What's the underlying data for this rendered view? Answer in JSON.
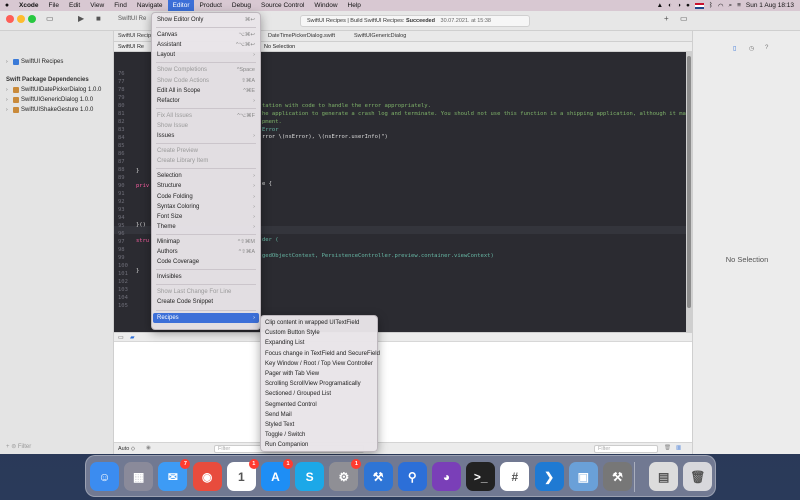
{
  "menubar": {
    "app_name": "Xcode",
    "items": [
      "File",
      "Edit",
      "View",
      "Find",
      "Navigate",
      "Editor",
      "Product",
      "Debug",
      "Source Control",
      "Window",
      "Help"
    ],
    "datetime": "Sun 1 Aug  18:13"
  },
  "toolbar": {
    "scheme_label": "SwiftUI Re",
    "status_project": "SwiftUI Recipes | Build SwiftUI Recipes: ",
    "status_result": "Succeeded",
    "status_time": "30.07.2021. at 15:38"
  },
  "tabs": [
    "SwiftUI Recipes",
    "DateTimePickerDialog.swift",
    "SwiftUIGenericDialog"
  ],
  "jumpbar": {
    "left": "SwiftUI Re",
    "right": "No Selection"
  },
  "navigator": {
    "project": "SwiftUI Recipes",
    "section_title": "Swift Package Dependencies",
    "packages": [
      "SwiftUIDatePickerDialog 1.0.0",
      "SwiftUIGenericDialog 1.0.0",
      "SwiftUIShakeGesture 1.0.0"
    ],
    "filter_placeholder": "Filter"
  },
  "editor_menu": {
    "items": [
      {
        "label": "Show Editor Only",
        "shortcut": "⌘↩",
        "enabled": true
      },
      {
        "sep": true
      },
      {
        "label": "Canvas",
        "shortcut": "⌥⌘↩",
        "enabled": true
      },
      {
        "label": "Assistant",
        "shortcut": "^⌥⌘↩",
        "enabled": true
      },
      {
        "label": "Layout",
        "shortcut": "›",
        "enabled": true
      },
      {
        "sep": true
      },
      {
        "label": "Show Completions",
        "shortcut": "^Space",
        "enabled": false
      },
      {
        "label": "Show Code Actions",
        "shortcut": "⇧⌘A",
        "enabled": false
      },
      {
        "label": "Edit All in Scope",
        "shortcut": "^⌘E",
        "enabled": true
      },
      {
        "label": "Refactor",
        "shortcut": "›",
        "enabled": true
      },
      {
        "sep": true
      },
      {
        "label": "Fix All Issues",
        "shortcut": "^⌥⌘F",
        "enabled": false
      },
      {
        "label": "Show Issue",
        "shortcut": "",
        "enabled": false
      },
      {
        "label": "Issues",
        "shortcut": "›",
        "enabled": true
      },
      {
        "sep": true
      },
      {
        "label": "Create Preview",
        "shortcut": "",
        "enabled": false
      },
      {
        "label": "Create Library Item",
        "shortcut": "",
        "enabled": false
      },
      {
        "sep": true
      },
      {
        "label": "Selection",
        "shortcut": "›",
        "enabled": true
      },
      {
        "label": "Structure",
        "shortcut": "›",
        "enabled": true
      },
      {
        "label": "Code Folding",
        "shortcut": "›",
        "enabled": true
      },
      {
        "label": "Syntax Coloring",
        "shortcut": "›",
        "enabled": true
      },
      {
        "label": "Font Size",
        "shortcut": "›",
        "enabled": true
      },
      {
        "label": "Theme",
        "shortcut": "›",
        "enabled": true
      },
      {
        "sep": true
      },
      {
        "label": "Minimap",
        "shortcut": "^⇧⌘M",
        "enabled": true
      },
      {
        "label": "Authors",
        "shortcut": "^⇧⌘A",
        "enabled": true
      },
      {
        "label": "Code Coverage",
        "shortcut": "",
        "enabled": true
      },
      {
        "sep": true
      },
      {
        "label": "Invisibles",
        "shortcut": "",
        "enabled": true
      },
      {
        "sep": true
      },
      {
        "label": "Show Last Change For Line",
        "shortcut": "",
        "enabled": false
      },
      {
        "label": "Create Code Snippet",
        "shortcut": "",
        "enabled": true
      },
      {
        "sep": true
      },
      {
        "label": "Recipes",
        "shortcut": "›",
        "enabled": true,
        "selected": true
      }
    ]
  },
  "recipes_menu": {
    "items": [
      "Clip content in wrapped UITextField",
      "Custom Button Style",
      "Expanding List",
      "Focus change in TextField and SecureField",
      "Key Window / Root / Top View Controller",
      "Pager with Tab View",
      "Scrolling ScrollView Programatically",
      "Sectioned / Grouped List",
      "Segmented Control",
      "Send Mail",
      "Styled Text",
      "Toggle / Switch",
      "Run Companion"
    ]
  },
  "code": {
    "lines": [
      {
        "t": "tation with code to handle the error appropriately.",
        "c": "comment"
      },
      {
        "t": "he application to generate a crash log and terminate. You should not use this function in a shipping application, although it may be",
        "c": "comment"
      },
      {
        "t": "pment.",
        "c": "comment"
      },
      {
        "t": "Error",
        "c": "teal"
      },
      {
        "t": "rror \\(nsError), \\(nsError.userInfo)\")",
        "c": "plain"
      },
      {
        "t": "e {",
        "c": "plain"
      },
      {
        "t": "der (",
        "c": "teal"
      },
      {
        "t": "gedObjectContext, PersistenceController.preview.container.viewContext)",
        "c": "teal"
      }
    ],
    "gutter_fragments": [
      "}",
      "priv",
      "}()",
      "stru",
      "}"
    ],
    "line_numbers": [
      "76",
      "77",
      "78",
      "79",
      "80",
      "81",
      "82",
      "83",
      "84",
      "85",
      "86",
      "87",
      "88",
      "89",
      "90",
      "91",
      "92",
      "93",
      "94",
      "95",
      "96",
      "97",
      "98",
      "99",
      "100",
      "101",
      "102",
      "103",
      "104",
      "105"
    ]
  },
  "debug": {
    "auto_label": "Auto ◇",
    "filter_placeholder": "Filter",
    "filter_placeholder_right": "Filter"
  },
  "inspector": {
    "empty_text": "No Selection"
  },
  "dock": {
    "apps": [
      {
        "name": "finder-icon",
        "glyph": "☺",
        "color": "#3b8cf0",
        "badge": ""
      },
      {
        "name": "launchpad-icon",
        "glyph": "▦",
        "color": "#8a8a9a",
        "badge": ""
      },
      {
        "name": "mail-icon",
        "glyph": "✉",
        "color": "#3d9bf5",
        "badge": "7"
      },
      {
        "name": "chrome-icon",
        "glyph": "◉",
        "color": "#e84c3d",
        "badge": ""
      },
      {
        "name": "calendar-icon",
        "glyph": "1",
        "color": "#ffffff",
        "badge": "1"
      },
      {
        "name": "app-store-icon",
        "glyph": "A",
        "color": "#1e8ef5",
        "badge": "1"
      },
      {
        "name": "skype-icon",
        "glyph": "S",
        "color": "#1ca8e8",
        "badge": ""
      },
      {
        "name": "system-preferences-icon",
        "glyph": "⚙",
        "color": "#8f8f95",
        "badge": "1"
      },
      {
        "name": "xcode-icon",
        "glyph": "⚒",
        "color": "#2e75d6",
        "badge": ""
      },
      {
        "name": "sourcetree-icon",
        "glyph": "⚲",
        "color": "#2c6fd8",
        "badge": ""
      },
      {
        "name": "github-desktop-icon",
        "glyph": "◕",
        "color": "#7a3fb8",
        "badge": ""
      },
      {
        "name": "terminal-icon",
        "glyph": ">_",
        "color": "#222222",
        "badge": ""
      },
      {
        "name": "slack-icon",
        "glyph": "#",
        "color": "#ffffff",
        "badge": ""
      },
      {
        "name": "vscode-icon",
        "glyph": "❯",
        "color": "#1f7ad3",
        "badge": ""
      },
      {
        "name": "preview-icon",
        "glyph": "▣",
        "color": "#6aa0d8",
        "badge": ""
      },
      {
        "name": "instruments-icon",
        "glyph": "⚒",
        "color": "#777777",
        "badge": ""
      },
      {
        "name": "downloads-stack-icon",
        "glyph": "▤",
        "color": "#dcdcdc",
        "badge": ""
      },
      {
        "name": "trash-icon",
        "glyph": "🗑",
        "color": "#d8d8dc",
        "badge": ""
      }
    ]
  }
}
